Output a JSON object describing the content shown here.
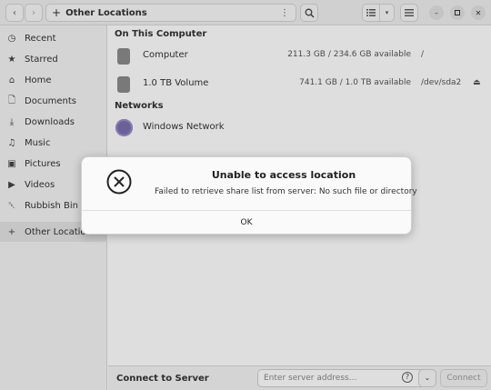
{
  "titlebar": {
    "back_icon": "chevron-left-icon",
    "forward_icon": "chevron-right-icon",
    "path_icon": "plus-icon",
    "path_label": "Other Locations",
    "menu_icon": "vertical-dots-icon",
    "search_icon": "search-icon",
    "view_list_icon": "list-view-icon",
    "view_options_icon": "chevron-down-icon",
    "hamburger_icon": "hamburger-menu-icon"
  },
  "sidebar": {
    "items": [
      {
        "label": "Recent",
        "icon": "clock-icon"
      },
      {
        "label": "Starred",
        "icon": "star-icon"
      },
      {
        "label": "Home",
        "icon": "home-icon"
      },
      {
        "label": "Documents",
        "icon": "document-icon"
      },
      {
        "label": "Downloads",
        "icon": "download-icon"
      },
      {
        "label": "Music",
        "icon": "music-icon"
      },
      {
        "label": "Pictures",
        "icon": "picture-icon"
      },
      {
        "label": "Videos",
        "icon": "video-icon"
      },
      {
        "label": "Rubbish Bin",
        "icon": "trash-icon"
      },
      {
        "label": "Other Locations",
        "icon": "plus-icon"
      }
    ]
  },
  "main": {
    "on_this_computer": "On This Computer",
    "devices": [
      {
        "name": "Computer",
        "space": "211.3 GB / 234.6 GB available",
        "mount": "/"
      },
      {
        "name": "1.0 TB Volume",
        "space": "741.1 GB / 1.0 TB available",
        "mount": "/dev/sda2"
      }
    ],
    "networks_title": "Networks",
    "network_items": [
      {
        "name": "Windows Network"
      }
    ]
  },
  "footer": {
    "label": "Connect to Server",
    "placeholder": "Enter server address...",
    "help": "?",
    "connect": "Connect"
  },
  "dialog": {
    "icon": "error-x-icon",
    "title": "Unable to access location",
    "message": "Failed to retrieve share list from server: No such file or directory",
    "ok": "OK"
  }
}
